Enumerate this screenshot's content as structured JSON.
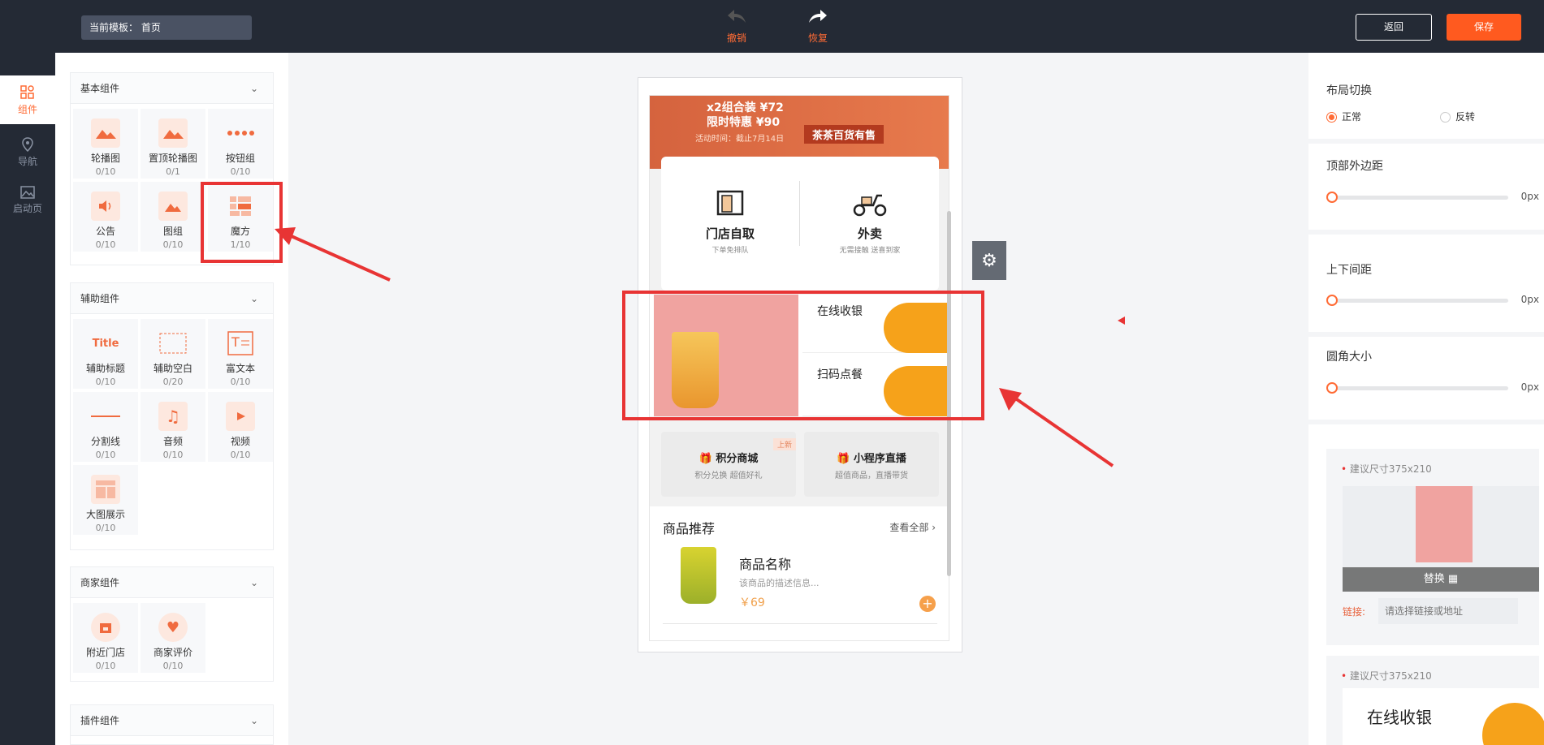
{
  "topbar": {
    "template_label": "当前模板：  首页",
    "undo_label": "撤销",
    "redo_label": "恢复",
    "back_label": "返回",
    "save_label": "保存"
  },
  "leftnav": {
    "items": [
      {
        "label": "组件",
        "icon": "grid-icon",
        "active": true
      },
      {
        "label": "导航",
        "icon": "location-pin-icon"
      },
      {
        "label": "启动页",
        "icon": "image-icon"
      }
    ]
  },
  "components": {
    "basic": {
      "title": "基本组件",
      "items": [
        {
          "label": "轮播图",
          "count": "0/10"
        },
        {
          "label": "置顶轮播图",
          "count": "0/1"
        },
        {
          "label": "按钮组",
          "count": "0/10"
        },
        {
          "label": "公告",
          "count": "0/10"
        },
        {
          "label": "图组",
          "count": "0/10"
        },
        {
          "label": "魔方",
          "count": "1/10"
        }
      ]
    },
    "aux": {
      "title": "辅助组件",
      "items": [
        {
          "label": "辅助标题",
          "count": "0/10"
        },
        {
          "label": "辅助空白",
          "count": "0/20"
        },
        {
          "label": "富文本",
          "count": "0/10"
        },
        {
          "label": "分割线",
          "count": "0/10"
        },
        {
          "label": "音频",
          "count": "0/10"
        },
        {
          "label": "视频",
          "count": "0/10"
        },
        {
          "label": "大图展示",
          "count": "0/10"
        }
      ]
    },
    "merchant": {
      "title": "商家组件",
      "items": [
        {
          "label": "附近门店",
          "count": "0/10"
        },
        {
          "label": "商家评价",
          "count": "0/10"
        }
      ]
    },
    "plugin": {
      "title": "插件组件"
    }
  },
  "preview": {
    "banner": {
      "line1": "x2组合装 ¥72",
      "line2": "限时特惠 ¥90",
      "date": "活动时间：截止7月14日",
      "tag": "茶茶百货有售"
    },
    "pick": {
      "self": {
        "name": "门店自取",
        "sub": "下单免排队"
      },
      "delivery": {
        "name": "外卖",
        "sub": "无需接触 送喜到家"
      }
    },
    "magic": {
      "cashier": "在线收银",
      "scan": "扫码点餐"
    },
    "minis": [
      {
        "title": "积分商城",
        "sub": "积分兑换  超值好礼",
        "tag": "上新"
      },
      {
        "title": "小程序直播",
        "sub": "超值商品，直播带货"
      }
    ],
    "goods": {
      "header": "商品推荐",
      "view_all": "查看全部",
      "name": "商品名称",
      "desc": "该商品的描述信息...",
      "price": "￥69"
    }
  },
  "settings": {
    "layout": {
      "title": "布局切换",
      "options": [
        "正常",
        "反转"
      ],
      "selected": "正常"
    },
    "top_margin": {
      "title": "顶部外边距",
      "value": "0px"
    },
    "spacing": {
      "title": "上下间距",
      "value": "0px"
    },
    "radius": {
      "title": "圆角大小",
      "value": "0px"
    },
    "image1": {
      "size_hint": "建议尺寸375x210",
      "replace": "替换",
      "link_label": "链接:",
      "link_placeholder": "请选择链接或地址"
    },
    "image2": {
      "size_hint": "建议尺寸375x210",
      "preview_text": "在线收银"
    }
  },
  "colors": {
    "accent": "#ff6b35",
    "dark": "#242a35",
    "highlight": "#e83434"
  }
}
